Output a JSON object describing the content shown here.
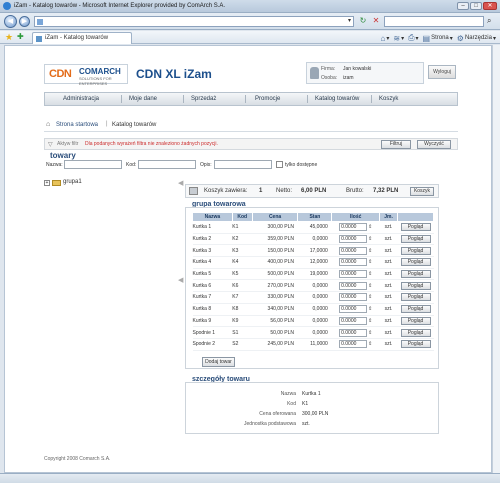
{
  "browser": {
    "title": "iZam - Katalog towarów - Microsoft Internet Explorer provided by ComArch S.A.",
    "tab_label": "iZam - Katalog towarów",
    "commands": [
      "Strona",
      "Narzędzia"
    ]
  },
  "header": {
    "logo_cdn": "CDN",
    "logo_comarch": "COMARCH",
    "logo_tagline": "SOLUTIONS FOR ENTERPRISES",
    "app_title": "CDN XL iZam",
    "firma_label": "Firma:",
    "firma_value": "Jan kowalski",
    "osoba_label": "Osoba:",
    "osoba_value": "izam",
    "logout_label": "Wyloguj"
  },
  "nav": {
    "items": [
      "Administracja",
      "Moje dane",
      "Sprzedaż",
      "Promocje",
      "Katalog towarów",
      "Koszyk"
    ]
  },
  "breadcrumb": {
    "home": "Strona startowa",
    "separator": "|",
    "current": "Katalog towarów"
  },
  "filter": {
    "label": "Aktyw filtr",
    "message": "Dla podanych wyrażeń filtra nie znaleziono żadnych pozycji.",
    "filter_button": "Filtruj",
    "clear_button": "Wyczyść"
  },
  "towary": {
    "title": "towary",
    "nazwa_label": "Nazwa:",
    "kod_label": "Kod:",
    "opis_label": "Opis:",
    "only_available_label": "tylko dostępne"
  },
  "tree": {
    "expand": "+",
    "group": "grupa1"
  },
  "summary": {
    "koszyk_label": "Koszyk zawiera:",
    "koszyk_count": "1",
    "netto_label": "Netto:",
    "netto_value": "6,00 PLN",
    "brutto_label": "Brutto:",
    "brutto_value": "7,32 PLN",
    "koszyk_button": "Koszyk"
  },
  "group": {
    "title": "grupa towarowa",
    "columns": [
      "Nazwa",
      "Kod",
      "Cena",
      "Stan",
      "Ilość",
      "Jm.",
      ""
    ],
    "rows": [
      {
        "name": "Kurtka 1",
        "code": "K1",
        "price": "300,00 PLN",
        "stock": "45,0000",
        "qty": "0.0000",
        "unit": "szt.",
        "action": "Pogląd"
      },
      {
        "name": "Kurtka 2",
        "code": "K2",
        "price": "359,00 PLN",
        "stock": "0,0000",
        "qty": "0.0000",
        "unit": "szt.",
        "action": "Pogląd"
      },
      {
        "name": "Kurtka 3",
        "code": "K3",
        "price": "150,00 PLN",
        "stock": "17,0000",
        "qty": "0.0000",
        "unit": "szt.",
        "action": "Pogląd"
      },
      {
        "name": "Kurtka 4",
        "code": "K4",
        "price": "400,00 PLN",
        "stock": "12,0000",
        "qty": "0.0000",
        "unit": "szt.",
        "action": "Pogląd"
      },
      {
        "name": "Kurtka 5",
        "code": "K5",
        "price": "500,00 PLN",
        "stock": "19,0000",
        "qty": "0.0000",
        "unit": "szt.",
        "action": "Pogląd"
      },
      {
        "name": "Kurtka 6",
        "code": "K6",
        "price": "270,00 PLN",
        "stock": "0,0000",
        "qty": "0.0000",
        "unit": "szt.",
        "action": "Pogląd"
      },
      {
        "name": "Kurtka 7",
        "code": "K7",
        "price": "330,00 PLN",
        "stock": "0,0000",
        "qty": "0.0000",
        "unit": "szt.",
        "action": "Pogląd"
      },
      {
        "name": "Kurtka 8",
        "code": "K8",
        "price": "340,00 PLN",
        "stock": "0,0000",
        "qty": "0.0000",
        "unit": "szt.",
        "action": "Pogląd"
      },
      {
        "name": "Kurtka 9",
        "code": "K9",
        "price": "56,00 PLN",
        "stock": "0,0000",
        "qty": "0.0000",
        "unit": "szt.",
        "action": "Pogląd"
      },
      {
        "name": "Spodnie 1",
        "code": "S1",
        "price": "50,00 PLN",
        "stock": "0,0000",
        "qty": "0.0000",
        "unit": "szt.",
        "action": "Pogląd"
      },
      {
        "name": "Spodnie 2",
        "code": "S2",
        "price": "245,00 PLN",
        "stock": "11,0000",
        "qty": "0.0000",
        "unit": "szt.",
        "action": "Pogląd"
      }
    ],
    "add_button": "Dodaj towar"
  },
  "details": {
    "title": "szczegóły towaru",
    "rows": [
      {
        "key": "Nazwa",
        "value": "Kurtka 1"
      },
      {
        "key": "Kod",
        "value": "K1"
      },
      {
        "key": "Cena oferowana",
        "value": "300,00 PLN"
      },
      {
        "key": "Jednostka podstawowa",
        "value": "szt."
      }
    ]
  },
  "footer": {
    "copyright": "Copyright 2008 Comarch S.A."
  },
  "colors": {
    "accent": "#1c4f8c",
    "brand_orange": "#e36c1a",
    "error": "#cc2b2b",
    "table_header": "#b8c8db"
  }
}
